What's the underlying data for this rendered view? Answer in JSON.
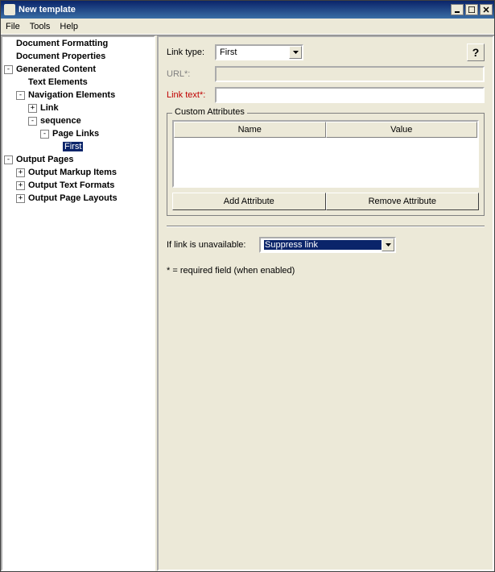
{
  "window": {
    "title": "New template"
  },
  "menu": {
    "file": "File",
    "tools": "Tools",
    "help": "Help"
  },
  "tree": {
    "doc_formatting": "Document Formatting",
    "doc_properties": "Document Properties",
    "generated_content": "Generated Content",
    "text_elements": "Text Elements",
    "nav_elements": "Navigation Elements",
    "link": "Link",
    "sequence": "sequence",
    "page_links": "Page Links",
    "first": "First",
    "output_pages": "Output Pages",
    "output_markup": "Output Markup Items",
    "output_text_formats": "Output Text Formats",
    "output_page_layouts": "Output Page Layouts"
  },
  "form": {
    "link_type_label": "Link type:",
    "link_type_value": "First",
    "url_label": "URL*:",
    "url_value": "",
    "link_text_label": "Link text*:",
    "link_text_value": "",
    "help": "?"
  },
  "custom_attributes": {
    "legend": "Custom Attributes",
    "col_name": "Name",
    "col_value": "Value",
    "add_btn": "Add Attribute",
    "remove_btn": "Remove Attribute"
  },
  "unavailable": {
    "label": "If link is unavailable:",
    "value": "Suppress link"
  },
  "footnote": "* = required field (when enabled)"
}
